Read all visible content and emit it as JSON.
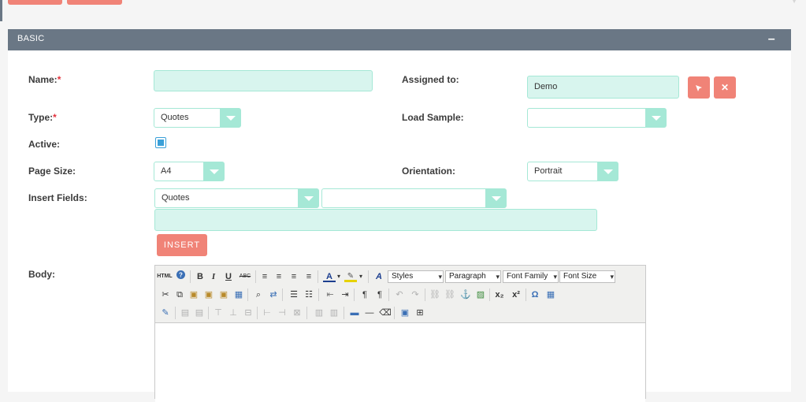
{
  "panel": {
    "title": "BASIC",
    "collapse_icon": "minus-icon"
  },
  "form": {
    "name": {
      "label": "Name:",
      "required_mark": "*",
      "value": ""
    },
    "assigned_to": {
      "label": "Assigned to:",
      "value": "Demo"
    },
    "type": {
      "label": "Type:",
      "required_mark": "*",
      "value": "Quotes"
    },
    "load_sample": {
      "label": "Load Sample:",
      "value": ""
    },
    "active": {
      "label": "Active:",
      "checked": true
    },
    "page_size": {
      "label": "Page Size:",
      "value": "A4"
    },
    "orientation": {
      "label": "Orientation:",
      "value": "Portrait"
    },
    "insert_fields": {
      "label": "Insert Fields:",
      "module": "Quotes",
      "field": "",
      "text": "",
      "button_label": "INSERT"
    },
    "body": {
      "label": "Body:"
    }
  },
  "editor": {
    "styles": "Styles",
    "format": "Paragraph",
    "font_family": "Font Family",
    "font_size": "Font Size",
    "html_label": "HTML",
    "bold": "B",
    "italic": "I",
    "underline": "U",
    "strike": "ABC",
    "subscript": "x₂",
    "superscript": "x²",
    "omega": "Ω"
  },
  "colors": {
    "accent": "#f08377",
    "header": "#6a7785",
    "field": "#d8f5ee",
    "field_border": "#a5e8d6"
  }
}
